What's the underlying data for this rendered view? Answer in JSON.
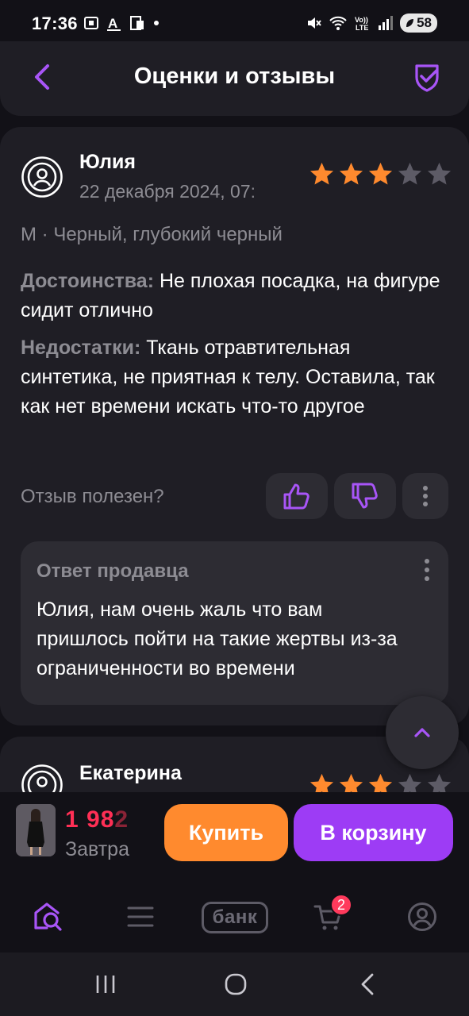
{
  "status_bar": {
    "time": "17:36",
    "battery": "58",
    "icons": [
      "screenshot-icon",
      "text-a-icon",
      "clipboard-icon",
      "dot-icon",
      "mute-icon",
      "wifi-icon",
      "volte-icon",
      "signal-icon",
      "battery-icon"
    ],
    "network_label": "5",
    "volte_label": "Vo)) LTE"
  },
  "header": {
    "title": "Оценки и отзывы",
    "back_icon": "chevron-left-icon",
    "right_icon": "shield-check-icon"
  },
  "reviews": [
    {
      "author": "Юлия",
      "date": "22 декабря 2024, 07:",
      "rating": 3,
      "rating_max": 5,
      "variant": "М · Черный, глубокий черный",
      "pros_label": "Достоинства:",
      "pros_text": " Не плохая посадка, на фигуре сидит отлично",
      "cons_label": "Недостатки:",
      "cons_text": " Ткань отравтительная синтетика, не приятная к телу. Оставила, так как нет времени искать что-то другое",
      "helpful_prompt": "Отзыв полезен?",
      "seller_reply": {
        "title": "Ответ продавца",
        "text": "Юлия, нам очень жаль что вам пришлось пойти на такие жертвы из-за ограниченности во времени"
      }
    },
    {
      "author": "Екатерина",
      "rating": 3,
      "rating_max": 5
    }
  ],
  "purchase_bar": {
    "price_main": "1 98",
    "price_tail": "2",
    "delivery": "Завтра",
    "buy_label": "Купить",
    "cart_label": "В корзину"
  },
  "bottom_nav": {
    "items": [
      "search-home-icon",
      "catalog-icon",
      "bank",
      "cart-icon",
      "profile-icon"
    ],
    "bank_label": "банк",
    "cart_badge": "2"
  },
  "colors": {
    "accent": "#9d3cf5",
    "star": "#ff8a2e",
    "star_empty": "#5d5b66",
    "price": "#ff2f55",
    "buy": "#ff8a2e",
    "card": "#1f1e25",
    "background": "#121117"
  }
}
